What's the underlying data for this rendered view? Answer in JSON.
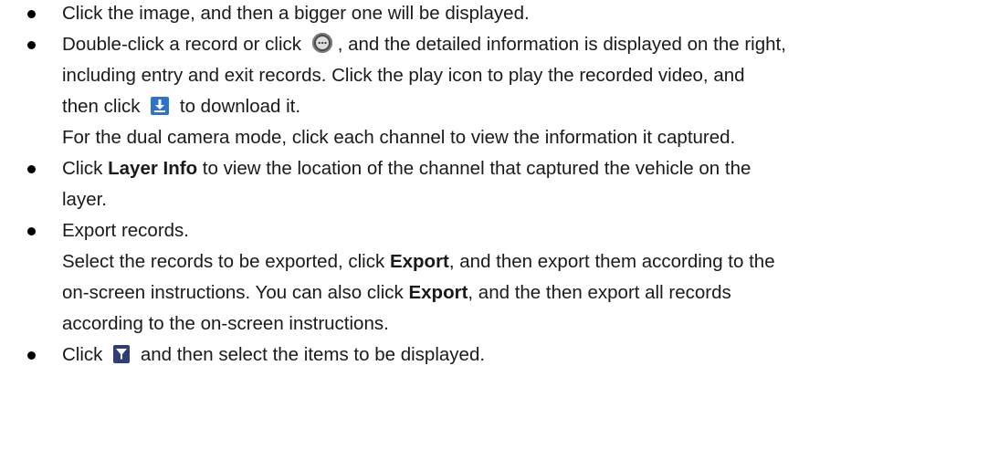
{
  "bullets": [
    {
      "line1": "Click the image, and then a bigger one will be displayed."
    },
    {
      "line1_a": "Double-click a record or click",
      "line1_b": ", and the detailed information is displayed on the right,",
      "line2": "including entry and exit records. Click the play icon to play the recorded video, and",
      "line3_a": "then click",
      "line3_b": "to download it.",
      "line4": "For the dual camera mode, click each channel to view the information it captured."
    },
    {
      "line1_a": "Click",
      "line1_bold": "Layer Info",
      "line1_b": "to view the location of the channel that captured the vehicle on the",
      "line2": "layer."
    },
    {
      "line1": "Export records.",
      "line2_a": "Select the records to be exported, click",
      "line2_bold": "Export",
      "line2_b": ",  and then export them according to the",
      "line3_a": "on-screen instructions. You can also click",
      "line3_bold": "Export",
      "line3_b": ",  and the then export all records",
      "line4": "according to the on-screen instructions."
    },
    {
      "line1_a": "Click",
      "line1_b": "and then select the items to be displayed."
    }
  ],
  "icons": {
    "more": "more-details-icon",
    "download": "download-icon",
    "filter": "filter-icon"
  },
  "colors": {
    "download_icon": "#2f73c9",
    "filter_icon": "#2e3f73",
    "more_icon": "#4a4a4a"
  }
}
